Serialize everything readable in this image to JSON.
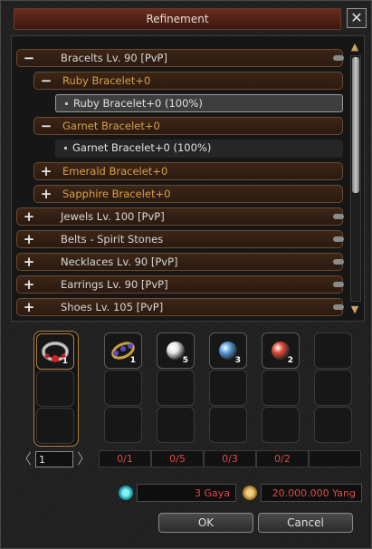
{
  "window": {
    "title": "Refinement",
    "close": "✕"
  },
  "tree": [
    {
      "kind": "group",
      "symbol": "−",
      "label": "Bracelts Lv. 90 [PvP]"
    },
    {
      "kind": "sub",
      "symbol": "−",
      "label": "Ruby Bracelet+0"
    },
    {
      "kind": "leaf",
      "label": "Ruby Bracelet+0 (100%)",
      "selected": true
    },
    {
      "kind": "sub",
      "symbol": "−",
      "label": "Garnet Bracelet+0"
    },
    {
      "kind": "leaf",
      "label": "Garnet Bracelet+0 (100%)",
      "selected": false
    },
    {
      "kind": "sub",
      "symbol": "+",
      "label": "Emerald Bracelet+0"
    },
    {
      "kind": "sub",
      "symbol": "+",
      "label": "Sapphire Bracelet+0"
    },
    {
      "kind": "group",
      "symbol": "+",
      "label": "Jewels Lv. 100 [PvP]"
    },
    {
      "kind": "group",
      "symbol": "+",
      "label": "Belts - Spirit Stones"
    },
    {
      "kind": "group",
      "symbol": "+",
      "label": "Necklaces Lv. 90 [PvP]"
    },
    {
      "kind": "group",
      "symbol": "+",
      "label": "Earrings Lv. 90 [PvP]"
    },
    {
      "kind": "group",
      "symbol": "+",
      "label": "Shoes Lv. 105 [PvP]"
    }
  ],
  "scrollbar": {
    "up": "▲",
    "down": "▼",
    "position": 0
  },
  "target_slot": {
    "item_icon": "ruby-bracelet-icon",
    "count": "1"
  },
  "materials": [
    {
      "icon": "gem-bracelet-icon",
      "count": "1",
      "color": "#6a5ab0",
      "required": "0/1"
    },
    {
      "icon": "white-pearl-icon",
      "count": "5",
      "color": "#e8e8e8",
      "required": "0/5"
    },
    {
      "icon": "blue-pearl-icon",
      "count": "3",
      "color": "#5aa0e0",
      "required": "0/3"
    },
    {
      "icon": "red-pearl-icon",
      "count": "2",
      "color": "#e04a3a",
      "required": "0/2"
    },
    {
      "icon": "",
      "count": "",
      "color": "",
      "required": ""
    }
  ],
  "pager": {
    "prev": "〈",
    "next": "〉",
    "page": "1"
  },
  "cost": {
    "gaya": "3 Gaya",
    "yang": "20.000.000 Yang"
  },
  "buttons": {
    "ok": "OK",
    "cancel": "Cancel"
  },
  "colors": {
    "title_bar": "#5a2418",
    "row_border": "#6b4a30",
    "sub_text": "#d8a048",
    "required_text": "#d84a4a"
  }
}
